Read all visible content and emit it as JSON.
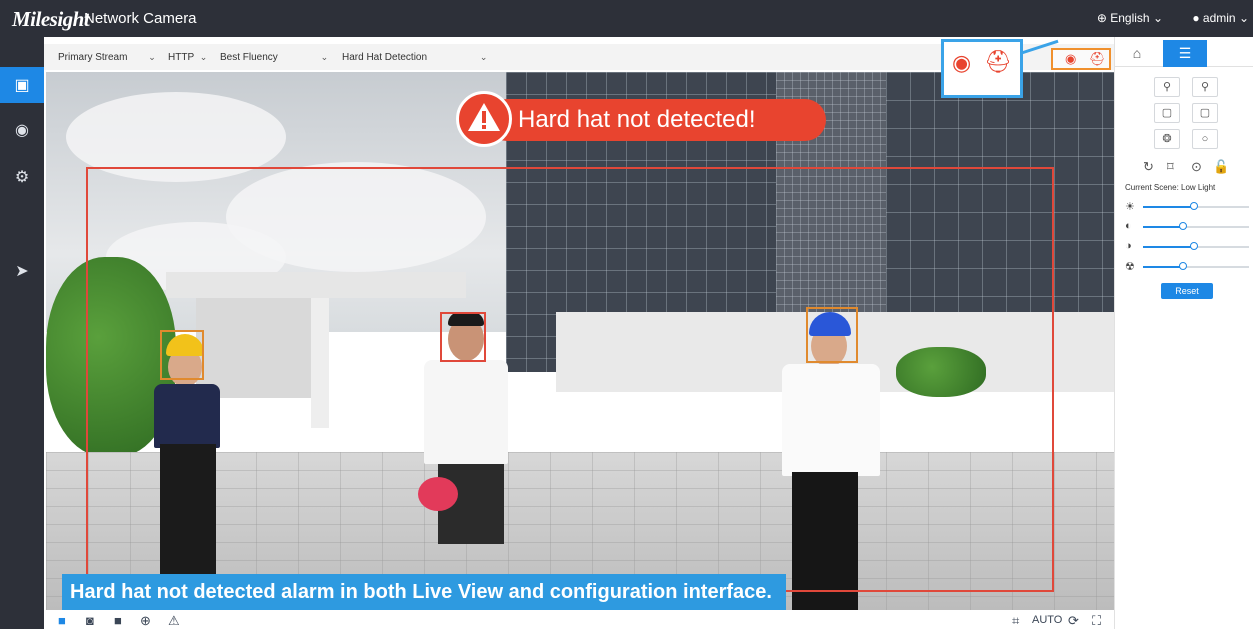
{
  "header": {
    "brand": "Milesight",
    "product": "Network Camera",
    "language": "English",
    "user": "admin"
  },
  "streambar": {
    "stream": "Primary Stream",
    "protocol": "HTTP",
    "fluency": "Best Fluency",
    "detection": "Hard Hat Detection"
  },
  "video": {
    "alarm_text": "Hard hat not detected!",
    "caption": "Hard hat not detected alarm in both Live View and configuration interface."
  },
  "bottombar": {
    "auto_label": "AUTO"
  },
  "rightpanel": {
    "scene_label": "Current Scene: Low Light",
    "reset_label": "Reset",
    "sliders": [
      {
        "icon": "brightness-icon",
        "value": 0.48
      },
      {
        "icon": "contrast-icon",
        "value": 0.38
      },
      {
        "icon": "saturation-icon",
        "value": 0.48
      },
      {
        "icon": "sharpness-icon",
        "value": 0.38
      }
    ]
  },
  "colors": {
    "accent": "#1e88e5",
    "alarm": "#e8442f",
    "caption": "#2e9ae0",
    "topbar": "#2d3039"
  }
}
